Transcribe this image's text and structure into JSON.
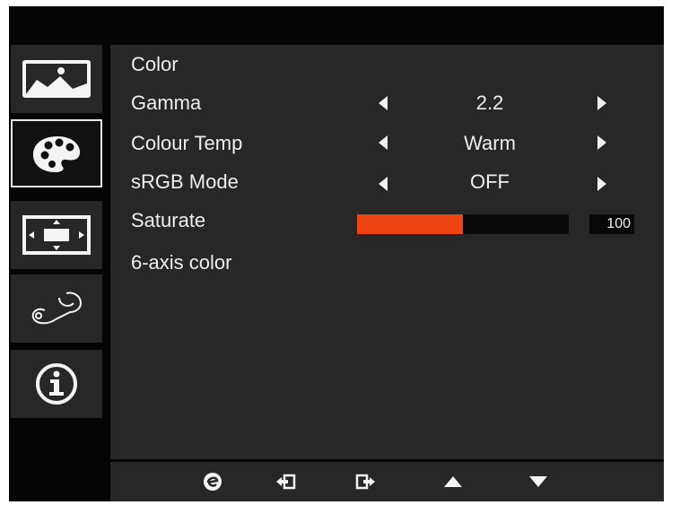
{
  "sidebar": {
    "tabs": [
      {
        "icon": "picture-icon",
        "selected": false
      },
      {
        "icon": "palette-icon",
        "selected": true
      },
      {
        "icon": "osd-position-icon",
        "selected": false
      },
      {
        "icon": "wrench-icon",
        "selected": false
      },
      {
        "icon": "info-icon",
        "selected": false
      }
    ]
  },
  "menu": {
    "title": "Color",
    "rows": [
      {
        "label": "Gamma",
        "value": "2.2"
      },
      {
        "label": "Colour Temp",
        "value": "Warm"
      },
      {
        "label": "sRGB Mode",
        "value": "OFF"
      },
      {
        "label": "Saturate",
        "level": 100,
        "value": "100"
      },
      {
        "label": "6-axis color"
      }
    ]
  },
  "bottom_bar": {
    "icons": [
      "e-key-icon",
      "enter-icon",
      "exit-icon",
      "up-arrow-icon",
      "down-arrow-icon"
    ]
  },
  "colors": {
    "accent": "#ee4312",
    "panel": "#272727",
    "background": "#050505"
  }
}
